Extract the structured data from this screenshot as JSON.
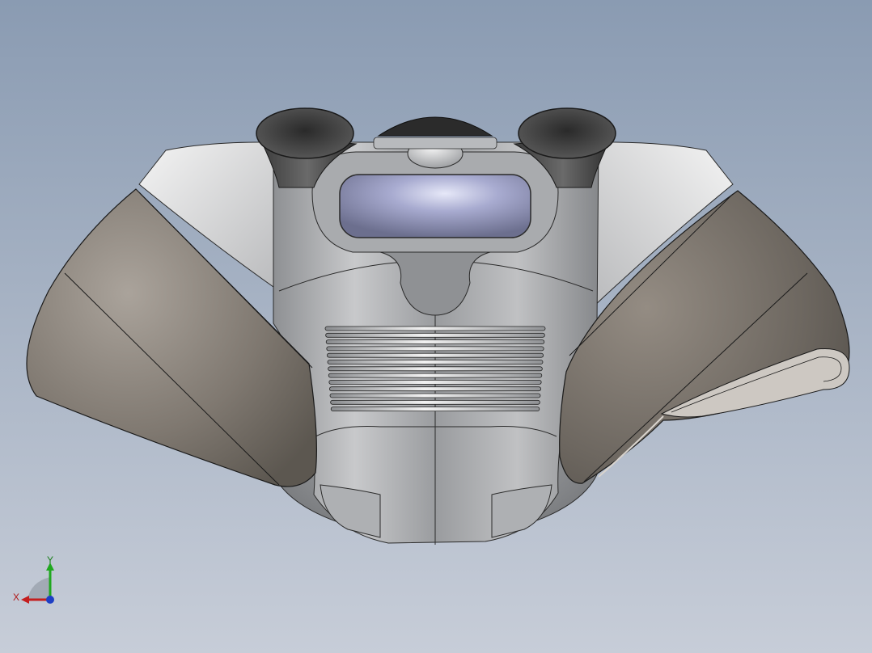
{
  "viewport": {
    "background_top": "#8a9bb2",
    "background_bottom": "#c7cdd8",
    "model_icon": "3d-part-icon"
  },
  "triad": {
    "x_label": "X",
    "y_label": "Y",
    "x_color": "#c41e1e",
    "y_color": "#1fa81f",
    "z_color": "#1e3fc4"
  }
}
